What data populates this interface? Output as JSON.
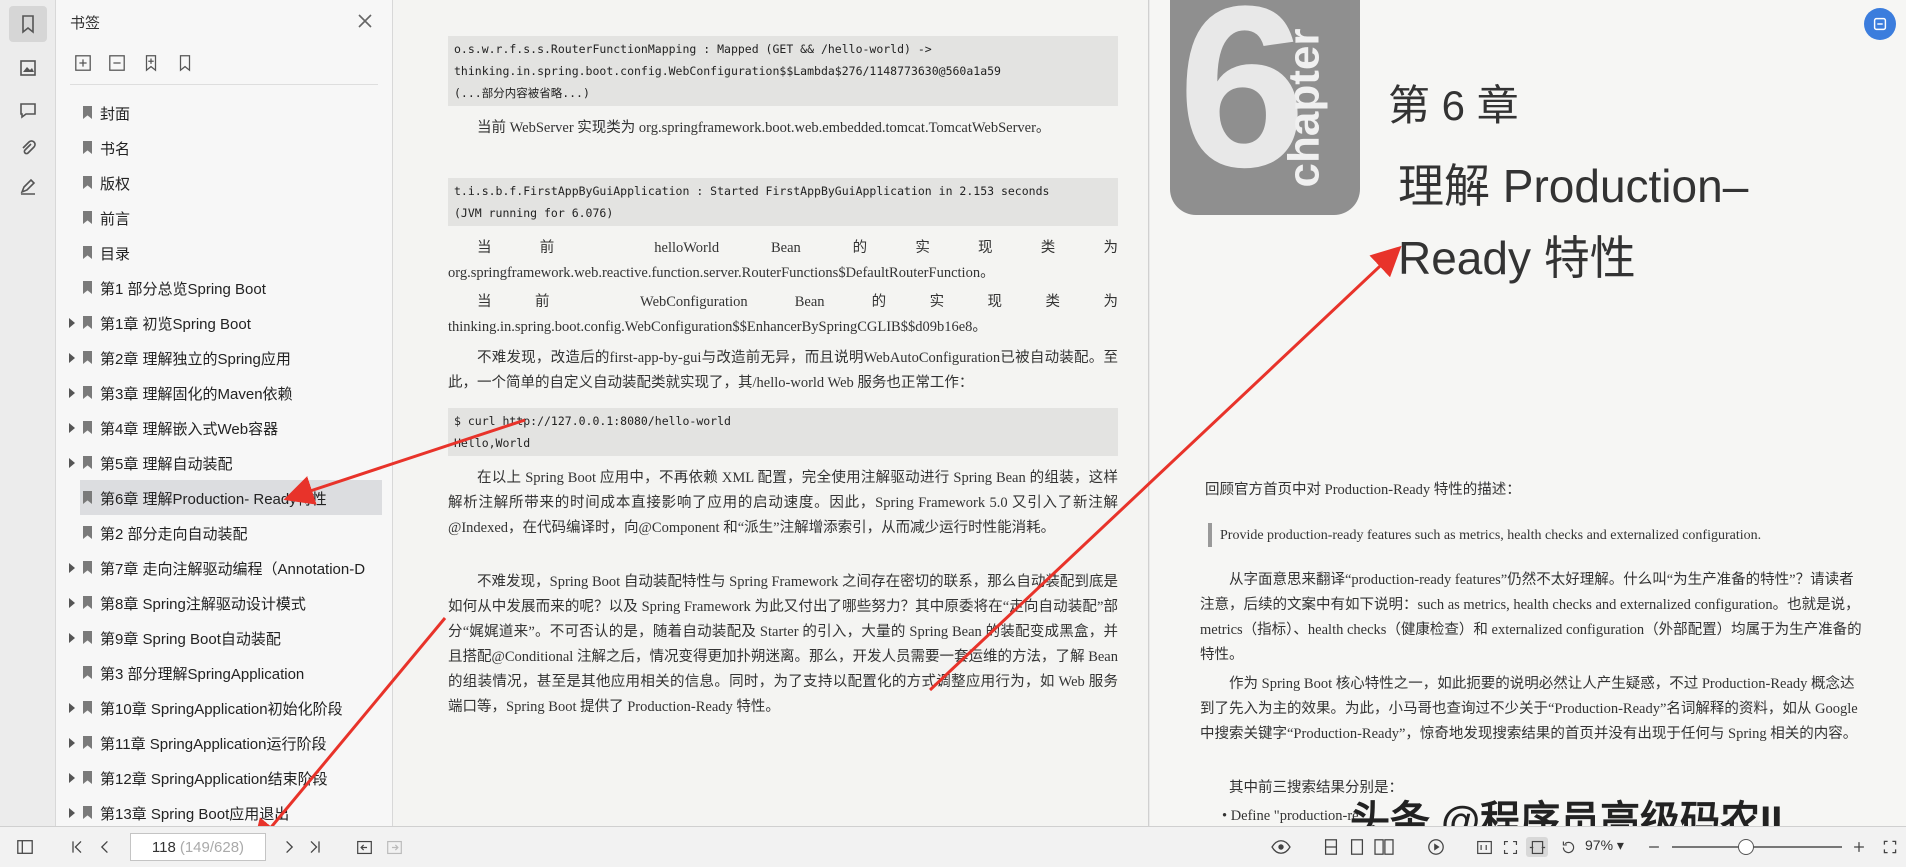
{
  "sidebar_panel": {
    "title": "书签",
    "bookmarks": [
      {
        "label": "封面",
        "expandable": false
      },
      {
        "label": "书名",
        "expandable": false
      },
      {
        "label": "版权",
        "expandable": false
      },
      {
        "label": "前言",
        "expandable": false
      },
      {
        "label": "目录",
        "expandable": false
      },
      {
        "label": "第1 部分总览Spring Boot",
        "expandable": false
      },
      {
        "label": "第1章 初览Spring Boot",
        "expandable": true
      },
      {
        "label": "第2章 理解独立的Spring应用",
        "expandable": true
      },
      {
        "label": "第3章 理解固化的Maven依赖",
        "expandable": true
      },
      {
        "label": "第4章 理解嵌入式Web容器",
        "expandable": true
      },
      {
        "label": "第5章 理解自动装配",
        "expandable": true
      },
      {
        "label": "第6章 理解Production- Ready特性",
        "expandable": true,
        "selected": true
      },
      {
        "label": "第2 部分走向自动装配",
        "expandable": false
      },
      {
        "label": "第7章 走向注解驱动编程（Annotation-D",
        "expandable": true
      },
      {
        "label": "第8章 Spring注解驱动设计模式",
        "expandable": true
      },
      {
        "label": "第9章 Spring Boot自动装配",
        "expandable": true
      },
      {
        "label": "第3 部分理解SpringApplication",
        "expandable": false
      },
      {
        "label": "第10章 SpringApplication初始化阶段",
        "expandable": true
      },
      {
        "label": "第11章 SpringApplication运行阶段",
        "expandable": true
      },
      {
        "label": "第12章 SpringApplication结束阶段",
        "expandable": true
      },
      {
        "label": "第13章 Spring Boot应用退出",
        "expandable": true
      }
    ]
  },
  "left_page": {
    "code1": [
      "o.s.w.r.f.s.s.RouterFunctionMapping      : Mapped (GET && /hello-world) ->",
      "thinking.in.spring.boot.config.WebConfiguration$$Lambda$276/1148773630@560a1a59",
      "    (...部分内容被省略...)"
    ],
    "p1": "当前 WebServer 实现类为 org.springframework.boot.web.embedded.tomcat.TomcatWebServer。",
    "code2": [
      "t.i.s.b.f.FirstAppByGuiApplication       : Started FirstAppByGuiApplication in 2.153 seconds",
      "(JVM running for 6.076)"
    ],
    "p2": "当前 helloWorld Bean 的实现类为 org.springframework.web.reactive.function.server.RouterFunctions$DefaultRouterFunction。",
    "p3": "当前 WebConfiguration Bean 的实现类为 thinking.in.spring.boot.config.WebConfiguration$$EnhancerBySpringCGLIB$$d09b16e8。",
    "p4": "不难发现，改造后的first-app-by-gui与改造前无异，而且说明WebAutoConfiguration已被自动装配。至此，一个简单的自定义自动装配类就实现了，其/hello-world Web 服务也正常工作：",
    "code3": [
      "$ curl http://127.0.0.1:8080/hello-world",
      "Hello,World"
    ],
    "p5": "在以上 Spring Boot 应用中，不再依赖 XML 配置，完全使用注解驱动进行 Spring Bean 的组装，这样解析注解所带来的时间成本直接影响了应用的启动速度。因此，Spring Framework 5.0 又引入了新注解@Indexed，在代码编译时，向@Component 和“派生”注解增添索引，从而减少运行时性能消耗。",
    "p6": "不难发现，Spring Boot 自动装配特性与 Spring Framework 之间存在密切的联系，那么自动装配到底是如何从中发展而来的呢？以及 Spring Framework 为此又付出了哪些努力？其中原委将在“走向自动装配”部分“娓娓道来”。不可否认的是，随着自动装配及 Starter 的引入，大量的 Spring Bean 的装配变成黑盒，并且搭配@Conditional 注解之后，情况变得更加扑朔迷离。那么，开发人员需要一套运维的方法，了解 Bean 的组装情况，甚至是其他应用相关的信息。同时，为了支持以配置化的方式调整应用行为，如 Web 服务端口等，Spring Boot 提供了 Production-Ready 特性。"
  },
  "right_page": {
    "chapter_digit": "6",
    "chapter_word": "chapter",
    "chapter_label": "第 6 章",
    "chapter_title_1": "理解 Production–",
    "chapter_title_2": "Ready 特性",
    "r1": "回顾官方首页中对 Production-Ready 特性的描述：",
    "quote": "Provide production-ready features such as metrics, health checks and externalized configuration.",
    "r2": "从字面意思来翻译“production-ready features”仍然不太好理解。什么叫“为生产准备的特性”？请读者注意，后续的文案中有如下说明：such as metrics, health checks and externalized configuration。也就是说，metrics（指标）、health checks（健康检查）和 externalized configuration（外部配置）均属于为生产准备的特性。",
    "r3": "作为 Spring Boot 核心特性之一，如此扼要的说明必然让人产生疑惑，不过 Production-Ready 概念达到了先入为主的效果。为此，小马哥也查询过不少关于“Production-Ready”名词解释的资料，如从 Google 中搜索关键字“Production-Ready”，惊奇地发现搜索结果的首页并没有出现于任何与 Spring 相关的内容。",
    "r4": "其中前三搜索结果分别是：",
    "r5": "•   Define \"production-re"
  },
  "watermark": "头条 @程序员高级码农II",
  "statusbar": {
    "current_page": "118",
    "page_total": "(149/628)",
    "zoom": "97%",
    "zoom_fraction": 0.43
  },
  "colors": {
    "accent": "#3b7ddd",
    "annotation_arrow": "#e8332a"
  }
}
